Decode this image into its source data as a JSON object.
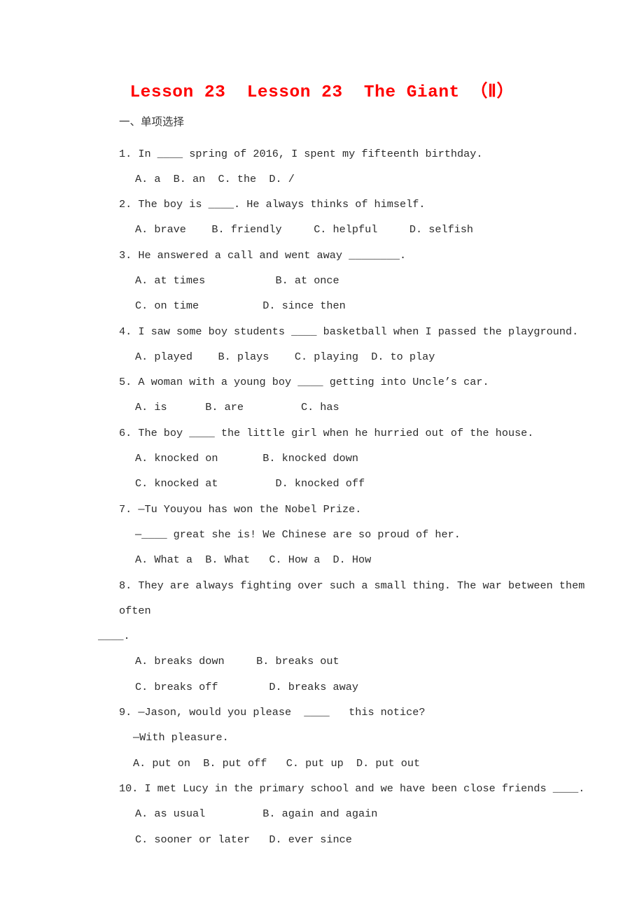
{
  "document": {
    "title": "Lesson 23  Lesson 23  The Giant （Ⅱ）",
    "title_color": "#ff0000",
    "background_color": "#ffffff",
    "text_color": "#2b2b2b"
  },
  "section": {
    "heading": "一、单项选择"
  },
  "questions": [
    {
      "number": "1.",
      "stem": "1. In ____ spring of 2016, I spent my fifteenth birthday.",
      "option_lines": [
        "A. a  B. an  C. the  D. /"
      ]
    },
    {
      "number": "2.",
      "stem": "2. The boy is ____. He always thinks of himself.",
      "option_lines": [
        "A. brave    B. friendly     C. helpful     D. selfish"
      ]
    },
    {
      "number": "3.",
      "stem": "3. He answered a call and went away ________.",
      "option_lines": [
        "A. at times           B. at once",
        "C. on time          D. since then"
      ]
    },
    {
      "number": "4.",
      "stem": "4. I saw some boy students ____ basketball when I passed the playground.",
      "option_lines": [
        "A. played    B. plays    C. playing  D. to play"
      ]
    },
    {
      "number": "5.",
      "stem": "5. A woman with a young boy ____ getting into Uncle’s car.",
      "option_lines": [
        "A. is      B. are         C. has"
      ]
    },
    {
      "number": "6.",
      "stem": "6. The boy ____ the little girl when he hurried out of the house.",
      "option_lines": [
        "A. knocked on       B. knocked down",
        "C. knocked at         D. knocked off"
      ]
    },
    {
      "number": "7.",
      "stem": "7. —Tu Youyou has won the Nobel Prize.",
      "continuation_lines": [
        "—____ great she is! We Chinese are so proud of her."
      ],
      "option_lines": [
        "A. What a  B. What   C. How a  D. How"
      ]
    },
    {
      "number": "8.",
      "stem": "8. They are always fighting over such a small thing. The war between them often",
      "wrap_tail": "____.",
      "option_lines": [
        "A. breaks down     B. breaks out",
        "C. breaks off        D. breaks away"
      ]
    },
    {
      "number": "9.",
      "stem": "9. —Jason, would you please  ____   this notice?",
      "continuation_lines": [
        "—With pleasure."
      ],
      "option_lines": [
        "A. put on  B. put off   C. put up  D. put out"
      ]
    },
    {
      "number": "10.",
      "stem": "10. I met Lucy in the primary school and we have been close friends ____.",
      "option_lines": [
        "A. as usual         B. again and again",
        "C. sooner or later   D. ever since"
      ]
    }
  ]
}
